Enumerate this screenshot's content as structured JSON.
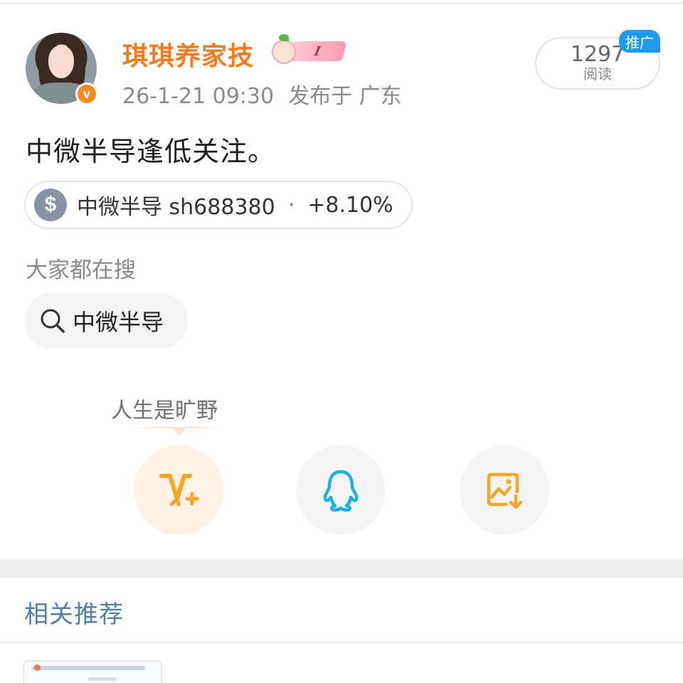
{
  "author": {
    "name": "琪琪养家技",
    "level_label": "I",
    "time": "26-1-21 09:30",
    "location": "发布于 广东"
  },
  "reads": {
    "count": "1297",
    "label": "阅读",
    "promo_tag": "推广"
  },
  "post": {
    "text": "中微半导逢低关注。"
  },
  "stock": {
    "name_code": "中微半导 sh688380",
    "separator": "·",
    "change": "+8.10%"
  },
  "hot_search": {
    "title": "大家都在搜",
    "query": "中微半导"
  },
  "share": {
    "tip": "人生是旷野"
  },
  "related": {
    "title": "相关推荐"
  },
  "colors": {
    "username": "#f77a1b",
    "promo_blue": "#1e9bf0",
    "related_title": "#4f7fa6",
    "weibo_orange": "#f5a623",
    "qq_blue": "#1bb1e6"
  },
  "icons": [
    "verified-icon",
    "level-badge-icon",
    "dollar-icon",
    "search-icon",
    "weibo-share-icon",
    "qq-icon",
    "save-image-icon"
  ]
}
